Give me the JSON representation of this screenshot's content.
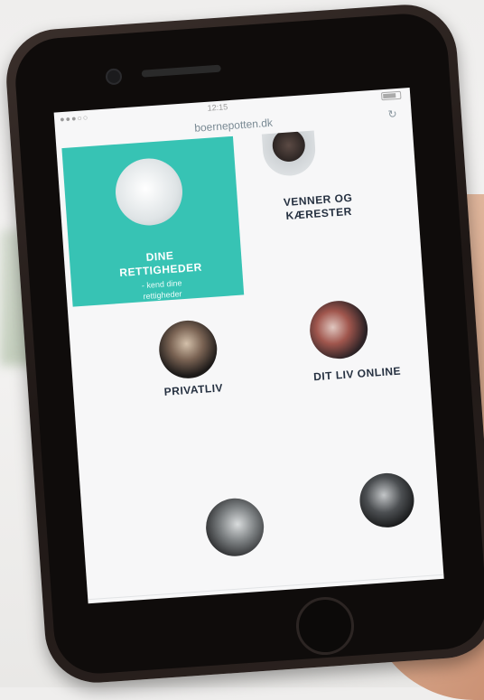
{
  "status": {
    "time": "12:15"
  },
  "browser": {
    "url": "boernepotten.dk"
  },
  "tiles": [
    {
      "title_l1": "DINE",
      "title_l2": "RETTIGHEDER",
      "subtitle_l1": "- kend dine",
      "subtitle_l2": "rettigheder",
      "color": "#37c3b4"
    },
    {
      "title_l1": "VENNER OG",
      "title_l2": "KÆRESTER",
      "subtitle_l1": "",
      "subtitle_l2": ""
    },
    {
      "title_l1": "PRIVATLIV",
      "subtitle_l1": "",
      "subtitle_l2": ""
    },
    {
      "title_l1": "DIT LIV ONLINE",
      "subtitle_l1": "",
      "subtitle_l2": ""
    }
  ],
  "photos": [
    {
      "icon": "person-photo"
    },
    {
      "icon": "person-photo"
    },
    {
      "icon": "couple-photo"
    },
    {
      "icon": "person-photo"
    },
    {
      "icon": "person-photo"
    }
  ]
}
